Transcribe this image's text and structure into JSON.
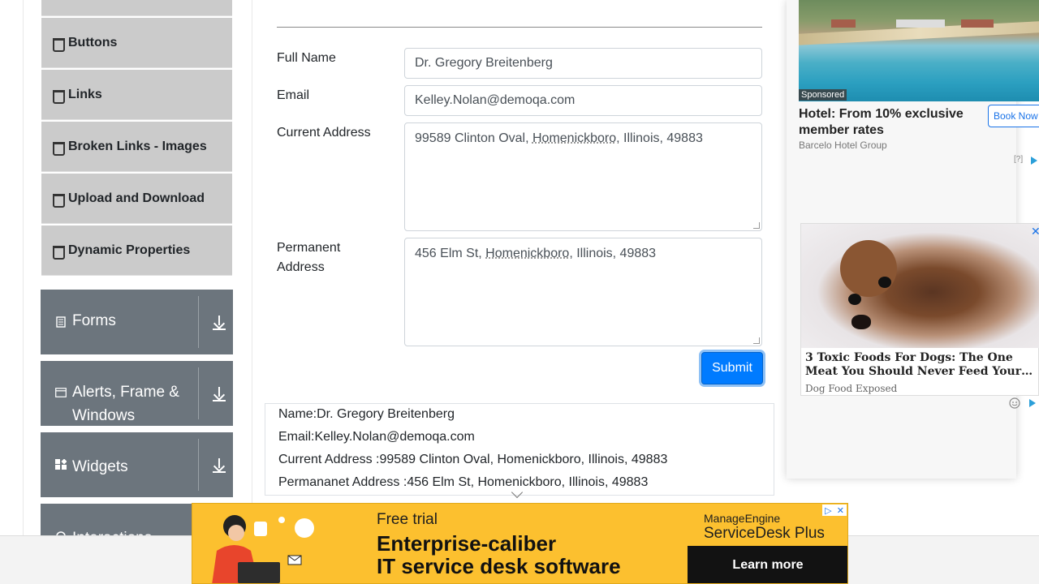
{
  "sidebar": {
    "sub_items": [
      "Buttons",
      "Links",
      "Broken Links - Images",
      "Upload and Download",
      "Dynamic Properties"
    ],
    "groups": [
      "Forms",
      "Alerts, Frame & Windows",
      "Widgets",
      "Interactions"
    ]
  },
  "form": {
    "full_name_label": "Full Name",
    "full_name_value": "Dr. Gregory Breitenberg",
    "email_label": "Email",
    "email_value": "Kelley.Nolan@demoqa.com",
    "current_address_label": "Current Address",
    "current_address_prefix": "99589 Clinton Oval, ",
    "current_address_city": "Homenickboro",
    "current_address_suffix": ", Illinois, 49883",
    "permanent_address_label": "Permanent Address",
    "permanent_address_prefix": "456 Elm St, ",
    "permanent_address_city": "Homenickboro",
    "permanent_address_suffix": ", Illinois, 49883",
    "submit_label": "Submit"
  },
  "output": {
    "name": "Name:Dr. Gregory Breitenberg",
    "email": "Email:Kelley.Nolan@demoqa.com",
    "current_address": "Current Address :99589 Clinton Oval, Homenickboro, Illinois, 49883",
    "permanent_address": "Permananet Address :456 Elm St, Homenickboro, Illinois, 49883"
  },
  "ads": {
    "hotel": {
      "sponsored": "Sponsored",
      "title": "Hotel: From 10% exclusive member rates",
      "brand": "Barcelo Hotel Group",
      "button": "Book Now",
      "question": "[?]"
    },
    "dog": {
      "title": "3 Toxic Foods For Dogs: The One Meat You Should Never Feed Your…",
      "source": "Dog Food Exposed",
      "close": "✕"
    },
    "banner": {
      "trial": "Free trial",
      "headline1": "Enterprise-caliber",
      "headline2": "IT service desk software",
      "brand1": "ManageEngine",
      "brand2": "ServiceDesk Plus",
      "cta": "Learn more"
    }
  },
  "colors": {
    "submit": "#007bff",
    "sidebar_group": "#6c757d",
    "sidebar_item": "#cbcbcb",
    "banner": "#fcc02f"
  }
}
